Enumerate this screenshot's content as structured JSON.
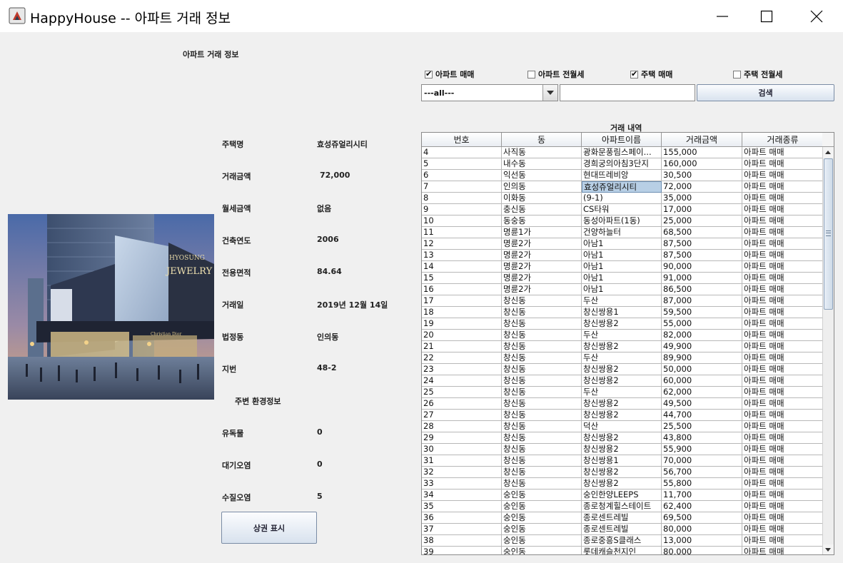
{
  "window": {
    "title": "HappyHouse -- 아파트 거래 정보",
    "icon": "java-app-icon"
  },
  "detail": {
    "section_title": "아파트 거래 정보",
    "fields": [
      {
        "label": "주택명",
        "value": "효성쥬얼리시티"
      },
      {
        "label": "거래금액",
        "value": "72,000"
      },
      {
        "label": "월세금액",
        "value": "없음"
      },
      {
        "label": "건축연도",
        "value": "2006"
      },
      {
        "label": "전용면적",
        "value": "84.64"
      },
      {
        "label": "거래일",
        "value": "2019년 12월 14일"
      },
      {
        "label": "법정동",
        "value": "인의동"
      },
      {
        "label": "지번",
        "value": "48-2"
      }
    ],
    "env_title": "주변 환경정보",
    "env": [
      {
        "label": "유독물",
        "value": "0"
      },
      {
        "label": "대기오염",
        "value": "0"
      },
      {
        "label": "수질오염",
        "value": "5"
      }
    ],
    "show_button": "상권 표시",
    "photo_signs": [
      "HYOSUNG",
      "JEWELRY",
      "Christian Dior"
    ]
  },
  "filters": {
    "checkboxes": [
      {
        "label": "아파트 매매",
        "checked": true
      },
      {
        "label": "아파트 전월세",
        "checked": false
      },
      {
        "label": "주택 매매",
        "checked": true
      },
      {
        "label": "주택 전월세",
        "checked": false
      }
    ],
    "combo_value": "---all---",
    "search_value": "",
    "search_button": "검색"
  },
  "table": {
    "caption": "거래 내역",
    "columns": [
      "번호",
      "동",
      "아파트이름",
      "거래금액",
      "거래종류"
    ],
    "selected_row": 3,
    "selected_col": 2,
    "rows": [
      [
        "4",
        "사직동",
        "광화문풍림스페이...",
        "155,000",
        "아파트 매매"
      ],
      [
        "5",
        "내수동",
        "경희궁의아침3단지",
        "160,000",
        "아파트 매매"
      ],
      [
        "6",
        "익선동",
        "현대뜨레비앙",
        "30,500",
        "아파트 매매"
      ],
      [
        "7",
        "인의동",
        "효성쥬얼리시티",
        "72,000",
        "아파트 매매"
      ],
      [
        "8",
        "이화동",
        "(9-1)",
        "35,000",
        "아파트 매매"
      ],
      [
        "9",
        "충신동",
        "CS타워",
        "17,000",
        "아파트 매매"
      ],
      [
        "10",
        "동숭동",
        "동성아파트(1동)",
        "25,000",
        "아파트 매매"
      ],
      [
        "11",
        "명륜1가",
        "건양하늘터",
        "68,500",
        "아파트 매매"
      ],
      [
        "12",
        "명륜2가",
        "아남1",
        "87,500",
        "아파트 매매"
      ],
      [
        "13",
        "명륜2가",
        "아남1",
        "87,500",
        "아파트 매매"
      ],
      [
        "14",
        "명륜2가",
        "아남1",
        "90,000",
        "아파트 매매"
      ],
      [
        "15",
        "명륜2가",
        "아남1",
        "91,000",
        "아파트 매매"
      ],
      [
        "16",
        "명륜2가",
        "아남1",
        "86,500",
        "아파트 매매"
      ],
      [
        "17",
        "창신동",
        "두산",
        "87,000",
        "아파트 매매"
      ],
      [
        "18",
        "창신동",
        "창신쌍용1",
        "59,500",
        "아파트 매매"
      ],
      [
        "19",
        "창신동",
        "창신쌍용2",
        "55,000",
        "아파트 매매"
      ],
      [
        "20",
        "창신동",
        "두산",
        "82,000",
        "아파트 매매"
      ],
      [
        "21",
        "창신동",
        "창신쌍용2",
        "49,900",
        "아파트 매매"
      ],
      [
        "22",
        "창신동",
        "두산",
        "89,900",
        "아파트 매매"
      ],
      [
        "23",
        "창신동",
        "창신쌍용2",
        "50,000",
        "아파트 매매"
      ],
      [
        "24",
        "창신동",
        "창신쌍용2",
        "60,000",
        "아파트 매매"
      ],
      [
        "25",
        "창신동",
        "두산",
        "62,000",
        "아파트 매매"
      ],
      [
        "26",
        "창신동",
        "창신쌍용2",
        "49,500",
        "아파트 매매"
      ],
      [
        "27",
        "창신동",
        "창신쌍용2",
        "44,700",
        "아파트 매매"
      ],
      [
        "28",
        "창신동",
        "덕산",
        "25,500",
        "아파트 매매"
      ],
      [
        "29",
        "창신동",
        "창신쌍용2",
        "43,800",
        "아파트 매매"
      ],
      [
        "30",
        "창신동",
        "창신쌍용2",
        "55,900",
        "아파트 매매"
      ],
      [
        "31",
        "창신동",
        "창신쌍용1",
        "70,000",
        "아파트 매매"
      ],
      [
        "32",
        "창신동",
        "창신쌍용2",
        "56,700",
        "아파트 매매"
      ],
      [
        "33",
        "창신동",
        "창신쌍용2",
        "55,800",
        "아파트 매매"
      ],
      [
        "34",
        "숭인동",
        "숭인한양LEEPS",
        "11,700",
        "아파트 매매"
      ],
      [
        "35",
        "숭인동",
        "종로청계힐스테이트",
        "62,400",
        "아파트 매매"
      ],
      [
        "36",
        "숭인동",
        "종로센트레빌",
        "69,500",
        "아파트 매매"
      ],
      [
        "37",
        "숭인동",
        "종로센트레빌",
        "80,000",
        "아파트 매매"
      ],
      [
        "38",
        "숭인동",
        "종로중흥S클래스",
        "13,000",
        "아파트 매매"
      ],
      [
        "39",
        "숭인동",
        "롯데캐슬천지인",
        "80,000",
        "아파트 매매"
      ]
    ]
  }
}
